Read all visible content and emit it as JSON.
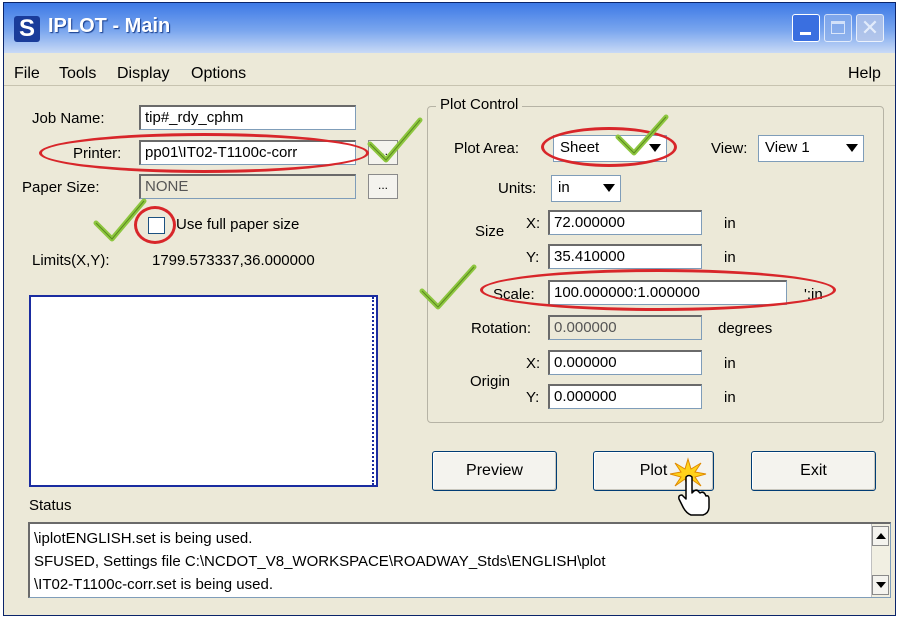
{
  "window": {
    "title": "IPLOT - Main",
    "close_glyph": "✕"
  },
  "menu": {
    "file": "File",
    "tools": "Tools",
    "display": "Display",
    "options": "Options",
    "help": "Help"
  },
  "job": {
    "job_name_label": "Job Name:",
    "job_name_value": "tip#_rdy_cphm",
    "printer_label": "Printer:",
    "printer_value": "pp01\\IT02-T1100c-corr",
    "paper_size_label": "Paper Size:",
    "paper_size_value": "NONE",
    "browse_label": "...",
    "use_full_paper_label": "Use full paper size",
    "use_full_paper_checked": false,
    "limits_label": "Limits(X,Y):",
    "limits_value": "1799.573337,36.000000"
  },
  "plot_control": {
    "title": "Plot Control",
    "plot_area_label": "Plot Area:",
    "plot_area_value": "Sheet",
    "view_label": "View:",
    "view_value": "View 1",
    "units_label": "Units:",
    "units_value": "in",
    "size_label": "Size",
    "x_label": "X:",
    "y_label": "Y:",
    "size_x": "72.000000",
    "size_y": "35.410000",
    "size_unit": "in",
    "scale_label": "Scale:",
    "scale_value": "100.000000:1.000000",
    "scale_unit": "':in",
    "rotation_label": "Rotation:",
    "rotation_value": "0.000000",
    "rotation_unit": "degrees",
    "origin_label": "Origin",
    "origin_x": "0.000000",
    "origin_y": "0.000000",
    "origin_unit": "in"
  },
  "actions": {
    "preview": "Preview",
    "plot": "Plot",
    "exit": "Exit"
  },
  "status": {
    "label": "Status",
    "lines": [
      "\\iplotENGLISH.set is being used.",
      "SFUSED, Settings file C:\\NCDOT_V8_WORKSPACE\\ROADWAY_Stds\\ENGLISH\\plot",
      "\\IT02-T1100c-corr.set is being used."
    ]
  },
  "icons": {
    "app": "iplot-logo-icon",
    "check": "checkmark-annotation-icon",
    "cursor": "hand-cursor-icon",
    "highlight": "red-ellipse-annotation"
  },
  "colors": {
    "annotation_red": "#d8262a",
    "annotation_green": "#8dc63f",
    "titlebar": "#3d79e6"
  }
}
